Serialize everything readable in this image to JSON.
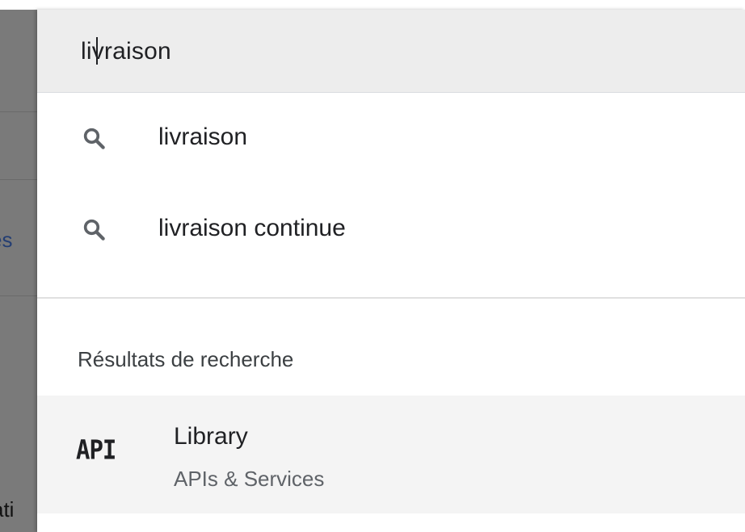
{
  "background": {
    "fragments": [
      {
        "text": "és",
        "style": "link"
      },
      {
        "text": "ati",
        "style": "dark"
      }
    ]
  },
  "search": {
    "value": "livraison"
  },
  "suggestions": [
    {
      "icon": "search-icon",
      "label": "livraison"
    },
    {
      "icon": "search-icon",
      "label": "livraison continue"
    }
  ],
  "results": {
    "heading": "Résultats de recherche",
    "items": [
      {
        "icon": "api-icon",
        "icon_text": "API",
        "title": "Library",
        "subtitle": "APIs & Services"
      }
    ]
  },
  "colors": {
    "overlay": "#7a7a7a",
    "search_bar_bg": "#ededed",
    "result_hover_bg": "#f4f4f4",
    "text_primary": "#202124",
    "text_secondary": "#5f6368",
    "link_text": "#243e73"
  }
}
